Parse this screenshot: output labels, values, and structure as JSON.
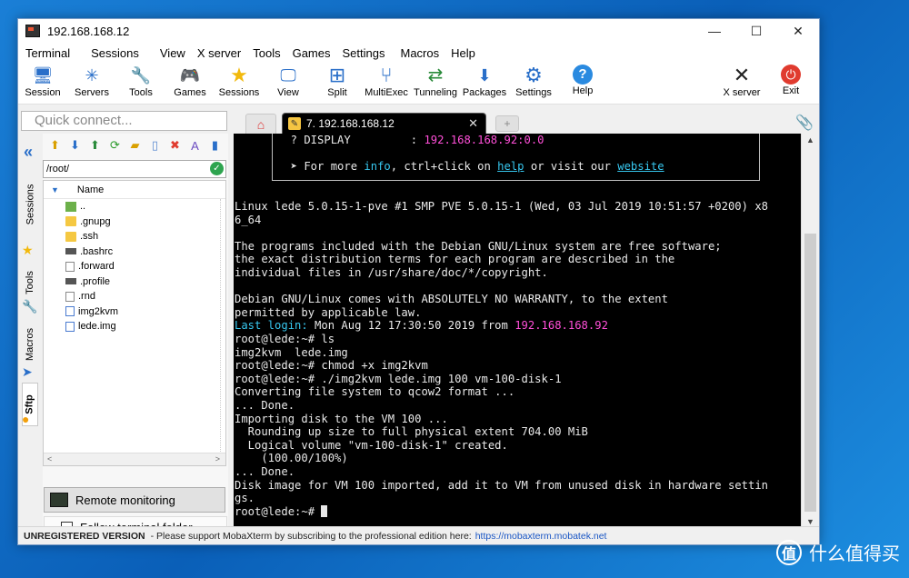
{
  "window": {
    "title": "192.168.168.12",
    "controls": [
      "—",
      "☐",
      "✕"
    ]
  },
  "menu": [
    "Terminal",
    "Sessions",
    "View",
    "X server",
    "Tools",
    "Games",
    "Settings",
    "Macros",
    "Help"
  ],
  "toolbar": {
    "left": [
      {
        "label": "Session",
        "icon": "session-icon",
        "glyph": "🖥"
      },
      {
        "label": "Servers",
        "icon": "servers-icon",
        "glyph": "✳"
      },
      {
        "label": "Tools",
        "icon": "tools-icon",
        "glyph": "🔧"
      },
      {
        "label": "Games",
        "icon": "games-icon",
        "glyph": "🎮"
      },
      {
        "label": "Sessions",
        "icon": "sessions-star-icon",
        "glyph": "★"
      },
      {
        "label": "View",
        "icon": "view-icon",
        "glyph": "🖵"
      },
      {
        "label": "Split",
        "icon": "split-icon",
        "glyph": "⊞"
      },
      {
        "label": "MultiExec",
        "icon": "multiexec-icon",
        "glyph": "⑂"
      },
      {
        "label": "Tunneling",
        "icon": "tunneling-icon",
        "glyph": "⇄"
      },
      {
        "label": "Packages",
        "icon": "packages-icon",
        "glyph": "⬇"
      },
      {
        "label": "Settings",
        "icon": "settings-icon",
        "glyph": "⚙"
      },
      {
        "label": "Help",
        "icon": "help-icon",
        "glyph": "?"
      }
    ],
    "right": [
      {
        "label": "X server",
        "icon": "xserver-icon",
        "glyph": "✕"
      },
      {
        "label": "Exit",
        "icon": "exit-icon",
        "glyph": "⏻"
      }
    ]
  },
  "quick_connect": {
    "placeholder": "Quick connect..."
  },
  "tabs": {
    "active_label": "7. 192.168.168.12",
    "close": "✕",
    "new_tab": "+"
  },
  "side_tabs": [
    "Sessions",
    "Tools",
    "Macros",
    "Sftp"
  ],
  "sftp": {
    "path": "/root/",
    "column": "Name",
    "files": [
      {
        "name": "..",
        "kind": "up"
      },
      {
        "name": ".gnupg",
        "kind": "folder"
      },
      {
        "name": ".ssh",
        "kind": "folder"
      },
      {
        "name": ".bashrc",
        "kind": "dark"
      },
      {
        "name": ".forward",
        "kind": "doc"
      },
      {
        "name": ".profile",
        "kind": "dark"
      },
      {
        "name": ".rnd",
        "kind": "doc"
      },
      {
        "name": "img2kvm",
        "kind": "docblue"
      },
      {
        "name": "lede.img",
        "kind": "docblue"
      }
    ],
    "monitor_label": "Remote monitoring",
    "follow_label": "Follow terminal folder"
  },
  "terminal": {
    "display_key": "  ? DISPLAY         : ",
    "display_val": "192.168.168.92:0.0",
    "more_pre": "  ➤ For more ",
    "more_info": "info",
    "more_mid": ", ctrl+click on ",
    "more_help": "help",
    "more_mid2": " or visit our ",
    "more_site": "website",
    "lines": [
      "Linux lede 5.0.15-1-pve #1 SMP PVE 5.0.15-1 (Wed, 03 Jul 2019 10:51:57 +0200) x8",
      "6_64",
      "",
      "The programs included with the Debian GNU/Linux system are free software;",
      "the exact distribution terms for each program are described in the",
      "individual files in /usr/share/doc/*/copyright.",
      "",
      "Debian GNU/Linux comes with ABSOLUTELY NO WARRANTY, to the extent",
      "permitted by applicable law."
    ],
    "last_login_label": "Last login:",
    "last_login_text": " Mon Aug 12 17:30:50 2019 from ",
    "last_login_ip": "192.168.168.92",
    "lines2": [
      "root@lede:~# ls",
      "img2kvm  lede.img",
      "root@lede:~# chmod +x img2kvm",
      "root@lede:~# ./img2kvm lede.img 100 vm-100-disk-1",
      "Converting file system to qcow2 format ...",
      "... Done.",
      "Importing disk to the VM 100 ...",
      "  Rounding up size to full physical extent 704.00 MiB",
      "  Logical volume \"vm-100-disk-1\" created.",
      "    (100.00/100%)",
      "... Done.",
      "Disk image for VM 100 imported, add it to VM from unused disk in hardware settin",
      "gs."
    ],
    "prompt": "root@lede:~# "
  },
  "status": {
    "label": "UNREGISTERED VERSION",
    "text": " -  Please support MobaXterm by subscribing to the professional edition here:",
    "link": "https://mobaxterm.mobatek.net"
  },
  "watermark": {
    "logo": "值",
    "text": "什么值得买"
  }
}
